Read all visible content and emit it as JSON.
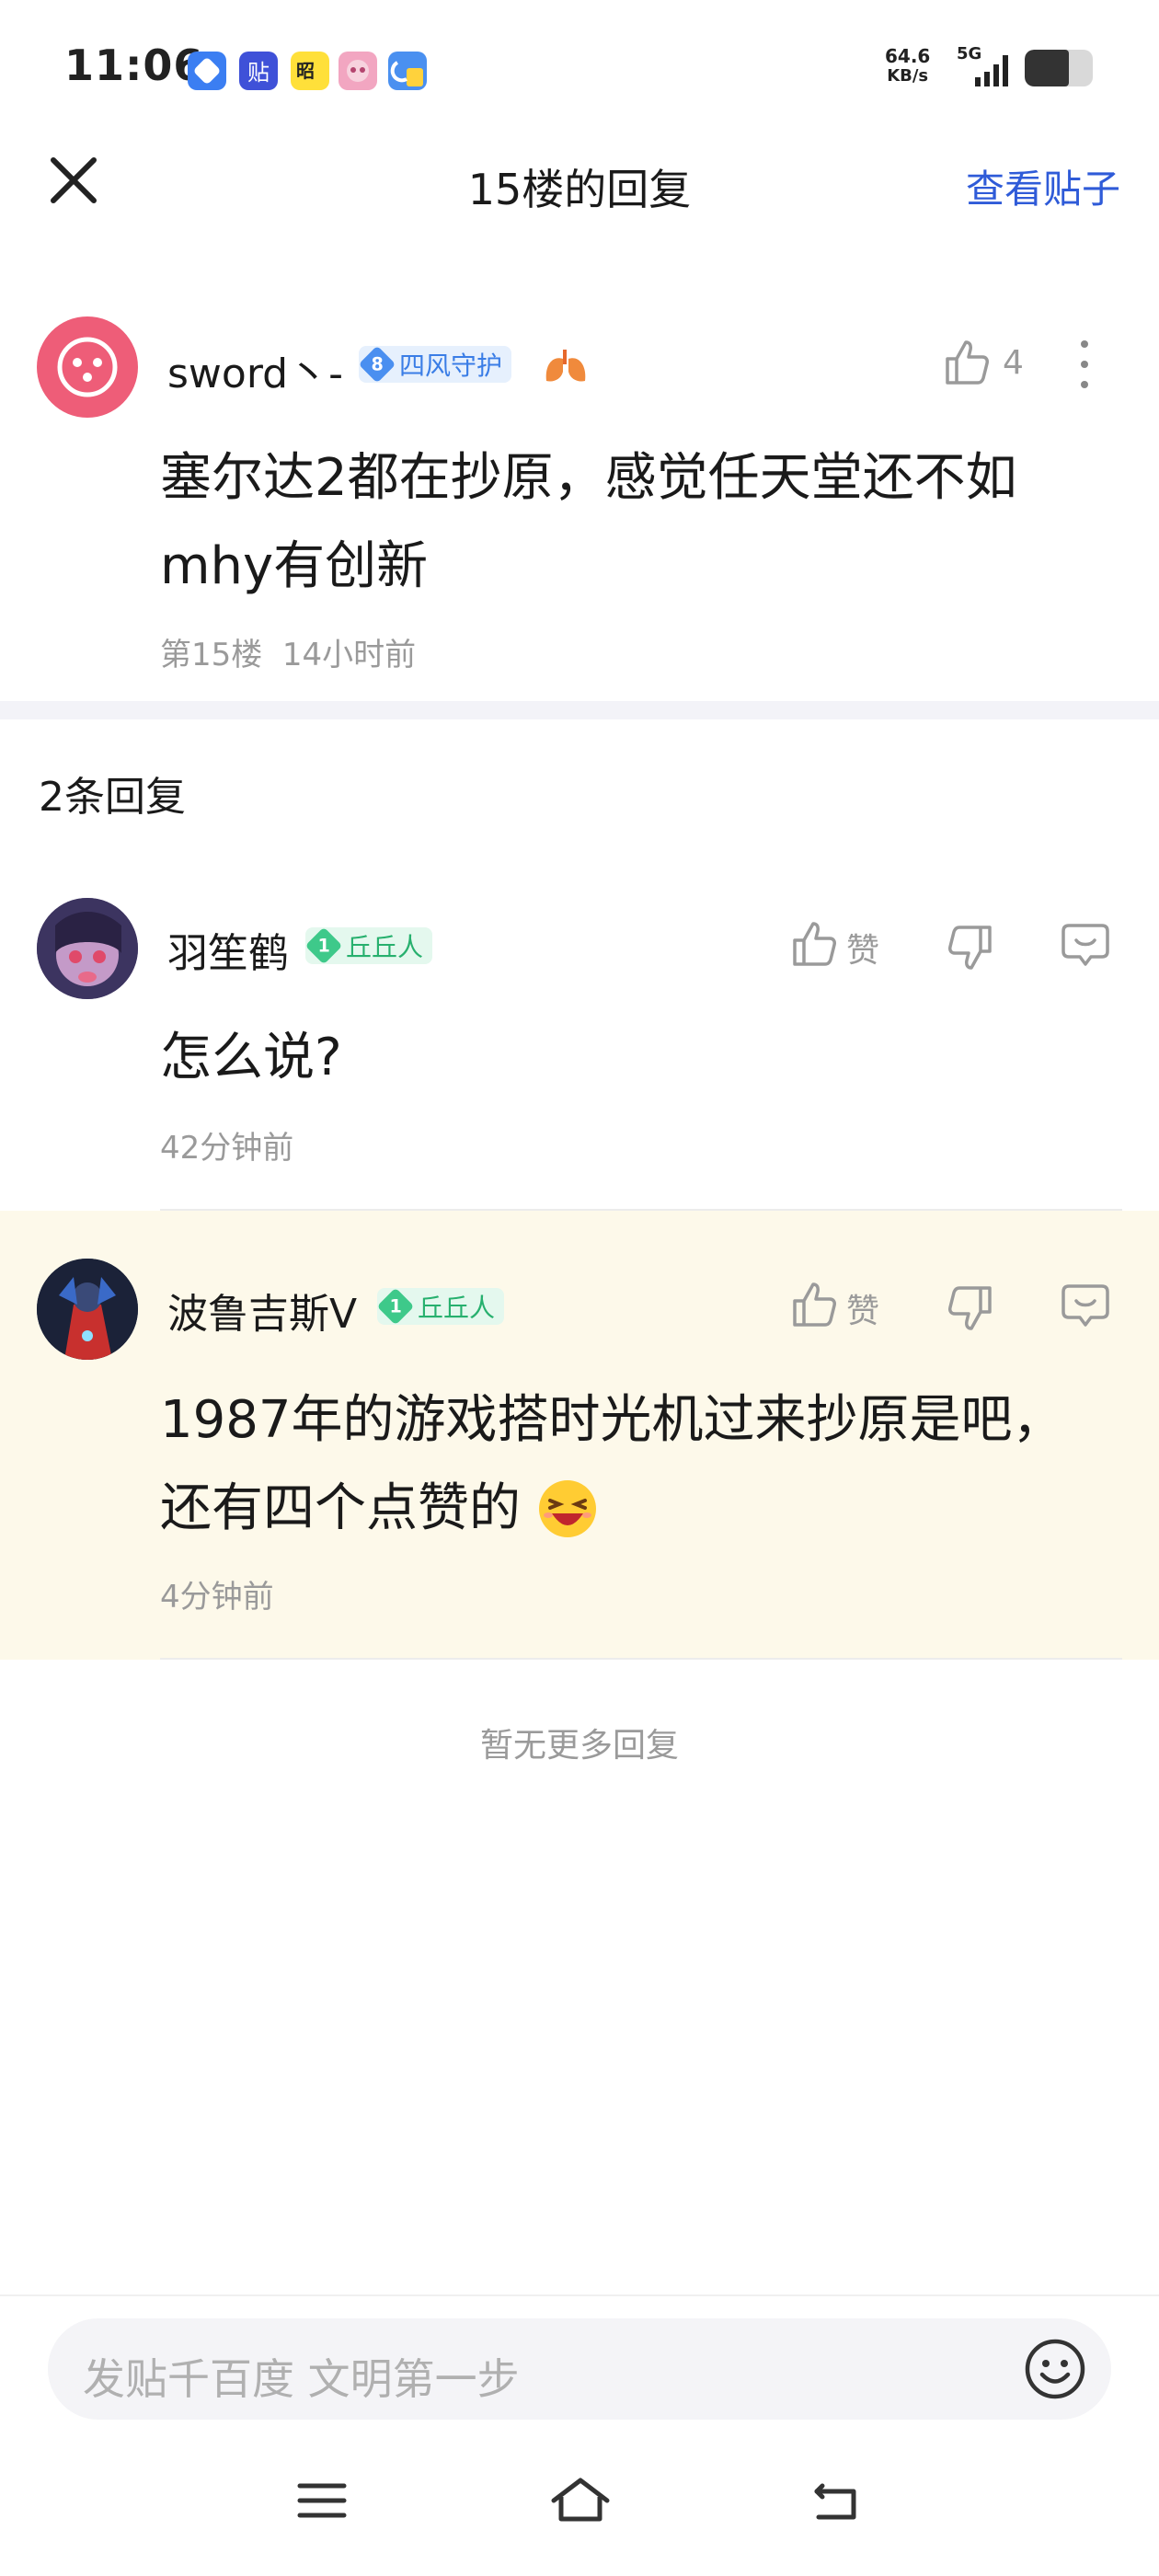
{
  "status_bar": {
    "time": "11:06",
    "net_speed": "64.6",
    "net_unit": "KB/s",
    "network": "5G",
    "app_icons": [
      "browser-icon",
      "tieba-icon",
      "game-icon",
      "anime-icon",
      "files-icon"
    ]
  },
  "header": {
    "title": "15楼的回复",
    "view_post": "查看贴子"
  },
  "main_post": {
    "username": "sword丶-",
    "level": "8",
    "badge": "四风守护",
    "like_count": "4",
    "text_line1": "塞尔达2都在抄原，感觉任天堂还不如",
    "text_line2": "mhy有创新",
    "floor": "第15楼",
    "time": "14小时前"
  },
  "replies_header": "2条回复",
  "replies": [
    {
      "username": "羽笙鹤",
      "level": "1",
      "badge": "丘丘人",
      "like_label": "赞",
      "text": "怎么说?",
      "time": "42分钟前"
    },
    {
      "username": "波鲁吉斯V",
      "level": "1",
      "badge": "丘丘人",
      "like_label": "赞",
      "text_line1": "1987年的游戏搭时光机过来抄原是吧，",
      "text_line2": "还有四个点赞的",
      "time": "4分钟前"
    }
  ],
  "no_more": "暂无更多回复",
  "input": {
    "placeholder": "发贴千百度 文明第一步"
  },
  "colors": {
    "accent": "#2f5bd8",
    "highlight_bg": "#fdf9ea",
    "badge_green": "#3ec98a",
    "badge_blue": "#4a8ff0"
  }
}
